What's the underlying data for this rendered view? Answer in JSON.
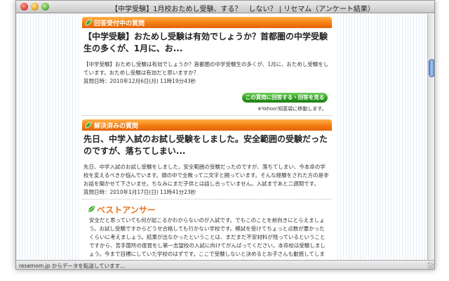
{
  "window": {
    "title": "【中学受験】1月校おためし受験、する？　しない？ | リセマム（アンケート結果）"
  },
  "question_open": {
    "section_label": "回答受付中の質問",
    "title": "【中学受験】おためし受験は有効でしょうか？首都圏の中学受験生の多くが、1月に、お...",
    "body": "【中学受験】おためし受験は有効でしょうか？首都圏の中学受験生の多くが、1月に、おためし受験をしています。おためし受験は有効だと思いますか？",
    "date": "質問日時：2010年12月6日(月) 11時19分43秒",
    "answer_button_label": "この質問に回答する・回答を見る",
    "yahoo_note": "※Yahoo!知恵袋に移動します。"
  },
  "question_solved": {
    "section_label": "解決済みの質問",
    "title": "先日、中学入試のお試し受験をしました。安全範囲の受験だったのですが、落ちてしまい...",
    "body": "先日、中学入試のお試し受験をしました。安全範囲の受験だったのですが、落ちてしまい、今本命の学校を変えるべきか悩んでいます。頭の中で全敗って二文字と闘っています。そんな経験をされた方の是非お話を聞かせて下さいませ。ちなみにまだ子供とは話し合っていません。入試まであと二週間です。",
    "date": "質問日時：2010年1月17日(日) 11時41分23秒"
  },
  "best_answer": {
    "label": "ベストアンサー",
    "body": "安全だと思っていても何が起こるかわからないのが入試です。でもこのことを前向きにとらえましょう。お試し受験ですからどうせ合格しても行かない学校です。模試を受けてちょっと点数が悪かったくらいに考えましょう。結果が出なかったということは、まだまだ不安材料が残っているということですから、苦手箇所の復習をし第一志望校の入試に向けてがんばってください。本命校は受験しましょう。今まで目標にしていた学校のはずです。ここで受験しないと決めるとお子さんも動揺してしまうと思います。そのかわり、併願対策もしっかりとしましょう。併願校はワンランク下げて確実に"
  },
  "status": {
    "text": "resemom.jp からデータを転送しています..."
  },
  "colors": {
    "section_orange": "#f47d12",
    "best_answer_orange": "#e8731a",
    "button_green": "#2e9b1f",
    "leaf_green": "#3fae2a"
  },
  "icons": {
    "section": "leaf-icon",
    "best_answer": "leaf-icon",
    "window_close": "close-icon",
    "window_minimize": "minimize-icon",
    "window_zoom": "zoom-icon"
  }
}
